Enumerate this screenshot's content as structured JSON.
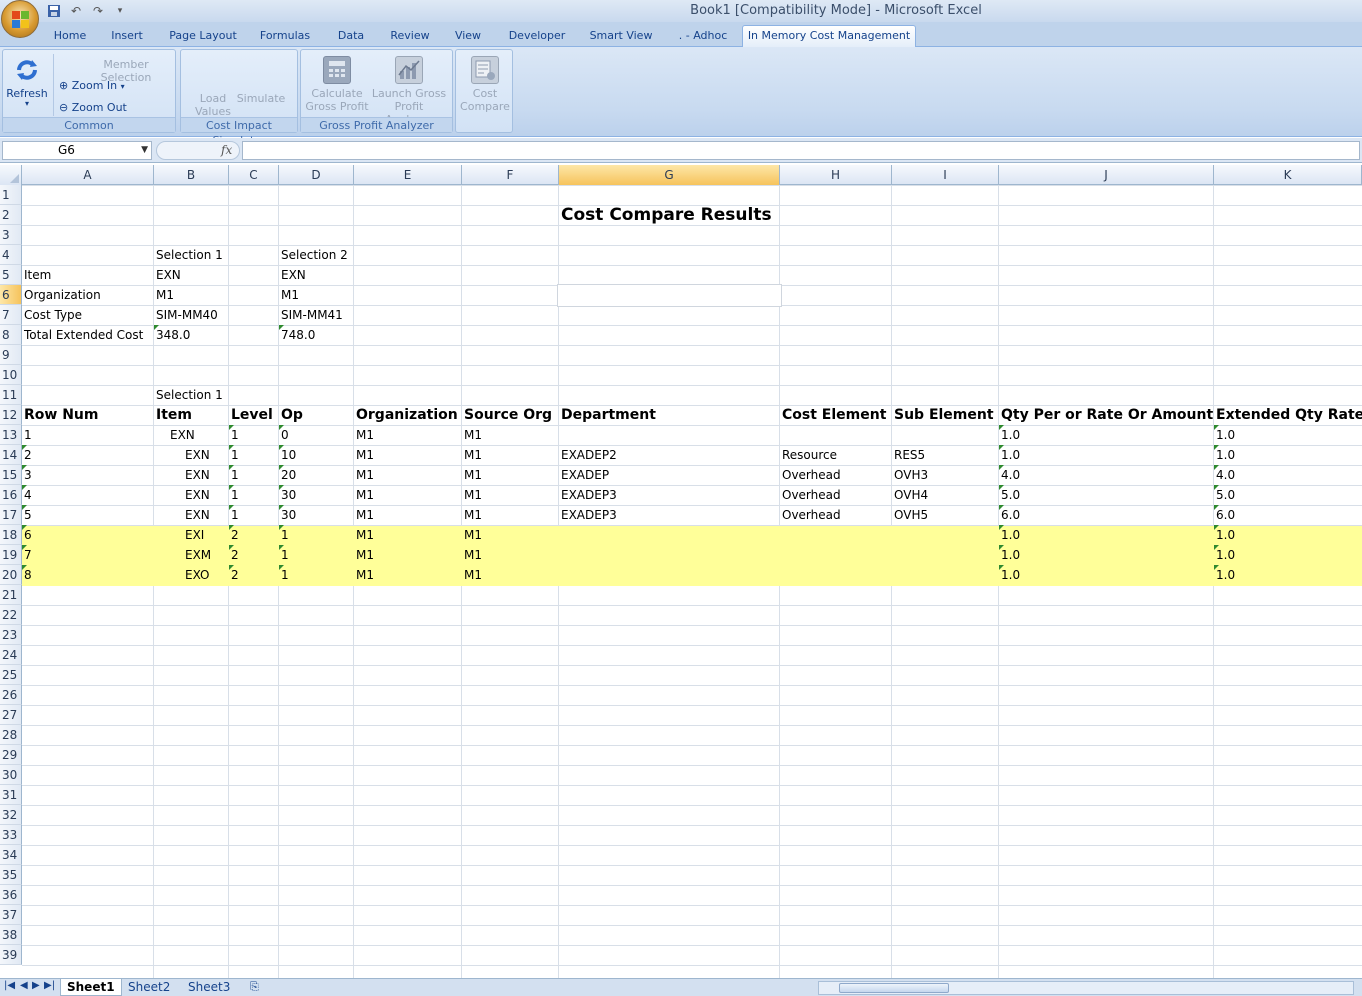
{
  "window": {
    "title": "Book1  [Compatibility Mode] - Microsoft Excel"
  },
  "tabs": [
    "Home",
    "Insert",
    "Page Layout",
    "Formulas",
    "Data",
    "Review",
    "View",
    "Developer",
    "Smart View",
    ". - Adhoc",
    "In Memory Cost Management"
  ],
  "ribbon": {
    "common": {
      "label": "Common",
      "refresh": "Refresh",
      "member_selection": "Member Selection",
      "zoom_in": "Zoom In",
      "zoom_out": "Zoom Out"
    },
    "cost_impact": {
      "label": "Cost Impact Simulator",
      "load": "Load",
      "values": "Values",
      "simulate": "Simulate"
    },
    "gross_profit": {
      "label": "Gross Profit Analyzer",
      "calc1": "Calculate",
      "calc2": "Gross Profit",
      "launch1": "Launch Gross",
      "launch2": "Profit Analyzer"
    },
    "cost_compare": {
      "cc1": "Cost",
      "cc2": "Compare"
    }
  },
  "formula_bar": {
    "name_box": "G6",
    "fx": "fx",
    "value": ""
  },
  "columns": [
    "A",
    "B",
    "C",
    "D",
    "E",
    "F",
    "G",
    "H",
    "I",
    "J",
    "K"
  ],
  "rows": [
    "1",
    "2",
    "3",
    "4",
    "5",
    "6",
    "7",
    "8",
    "9",
    "10",
    "11",
    "12",
    "13",
    "14",
    "15",
    "16",
    "17",
    "18",
    "19",
    "20",
    "21",
    "22",
    "23",
    "24",
    "25",
    "26",
    "27",
    "28",
    "29",
    "30",
    "31",
    "32",
    "33",
    "34",
    "35",
    "36",
    "37",
    "38",
    "39"
  ],
  "sheet": {
    "title": "Cost Compare Results",
    "selection1": "Selection 1",
    "selection2": "Selection 2",
    "summary": [
      {
        "label": "Item",
        "s1": "EXN",
        "s2": "EXN"
      },
      {
        "label": "Organization",
        "s1": "M1",
        "s2": "M1"
      },
      {
        "label": "Cost Type",
        "s1": "SIM-MM40",
        "s2": "SIM-MM41"
      },
      {
        "label": "Total Extended Cost",
        "s1": "348.0",
        "s2": "748.0"
      }
    ],
    "detail_selection": "Selection 1",
    "headers": [
      "Row Num",
      "Item",
      "Level",
      "Op",
      "Organization",
      "Source Org",
      "Department",
      "Cost Element",
      "Sub Element",
      "Qty Per or Rate Or Amount",
      "Extended Qty Rate"
    ],
    "data": [
      [
        "1",
        "EXN",
        "1",
        "0",
        "M1",
        "M1",
        "",
        "",
        "",
        "1.0",
        "1.0"
      ],
      [
        "2",
        "EXN",
        "1",
        "10",
        "M1",
        "M1",
        "EXADEP2",
        "Resource",
        "RES5",
        "1.0",
        "1.0"
      ],
      [
        "3",
        "EXN",
        "1",
        "20",
        "M1",
        "M1",
        "EXADEP",
        "Overhead",
        "OVH3",
        "4.0",
        "4.0"
      ],
      [
        "4",
        "EXN",
        "1",
        "30",
        "M1",
        "M1",
        "EXADEP3",
        "Overhead",
        "OVH4",
        "5.0",
        "5.0"
      ],
      [
        "5",
        "EXN",
        "1",
        "30",
        "M1",
        "M1",
        "EXADEP3",
        "Overhead",
        "OVH5",
        "6.0",
        "6.0"
      ],
      [
        "6",
        "EXI",
        "2",
        "1",
        "M1",
        "M1",
        "",
        "",
        "",
        "1.0",
        "1.0"
      ],
      [
        "7",
        "EXM",
        "2",
        "1",
        "M1",
        "M1",
        "",
        "",
        "",
        "1.0",
        "1.0"
      ],
      [
        "8",
        "EXO",
        "2",
        "1",
        "M1",
        "M1",
        "",
        "",
        "",
        "1.0",
        "1.0"
      ]
    ]
  },
  "sheet_tabs": [
    "Sheet1",
    "Sheet2",
    "Sheet3"
  ],
  "colors": {
    "highlight": "#ffff99",
    "accent": "#15428b"
  }
}
